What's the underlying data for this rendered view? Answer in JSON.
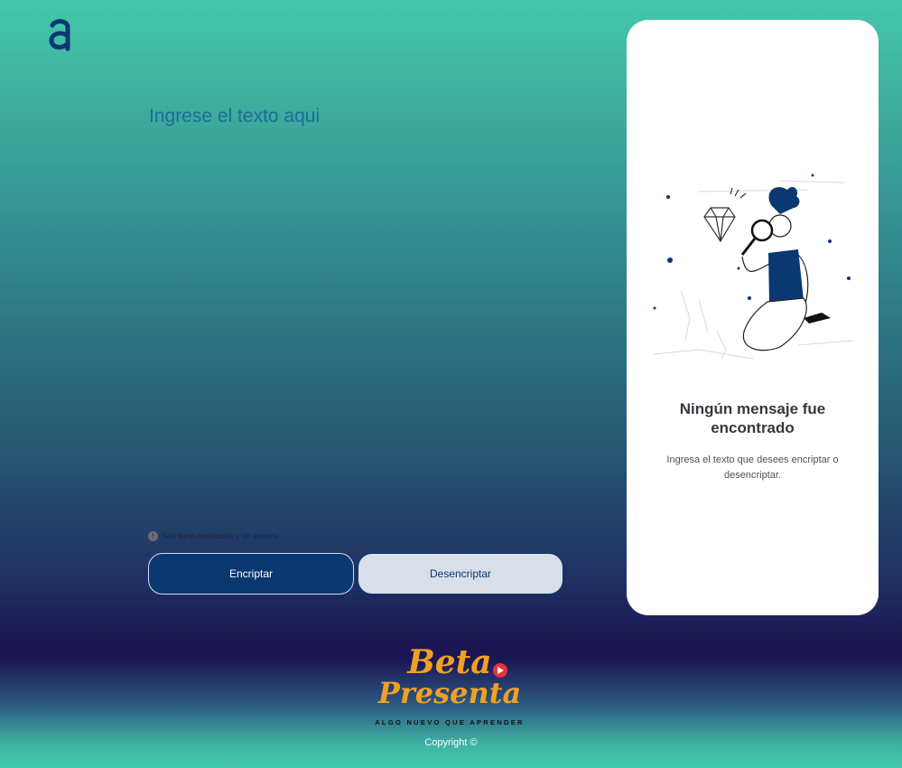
{
  "header": {
    "logo_icon": "alura-a-logo-icon",
    "logo_color": "#0a3871"
  },
  "editor": {
    "placeholder": "Ingrese el texto aqui"
  },
  "hint": {
    "icon": "info-icon",
    "icon_glyph": "!",
    "text": "Solo letras minúsculas y sin acentos"
  },
  "buttons": {
    "encrypt_label": "Encriptar",
    "decrypt_label": "Desencriptar"
  },
  "output": {
    "illustration": "person-with-magnifying-glass-illustration",
    "title": "Ningún mensaje fue encontrado",
    "text": "Ingresa el texto que desees encriptar o desencriptar."
  },
  "footer": {
    "brand_line1": "Beta",
    "brand_line2": "Presenta",
    "tagline": "ALGO NUEVO QUE APRENDER",
    "youtube_icon": "youtube-icon",
    "copyright": "Copyright ©"
  },
  "colors": {
    "primary": "#0a3871",
    "brand_orange": "#f0a024",
    "card_bg": "#ffffff",
    "button_light": "#d8dfe8"
  }
}
